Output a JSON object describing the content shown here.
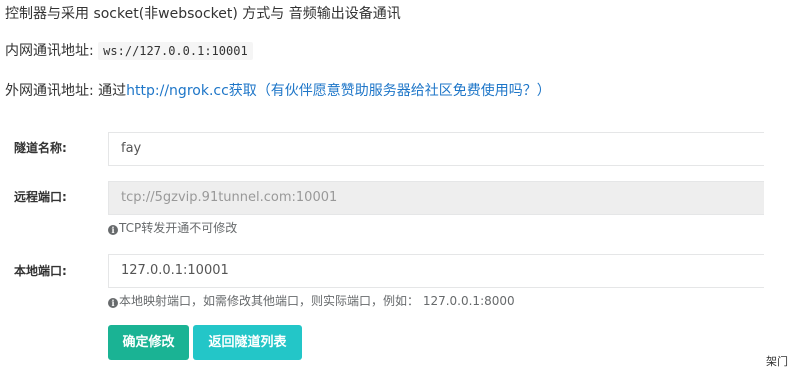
{
  "header": {
    "title": "控制器与采用 socket(非websocket) 方式与 音频输出设备通讯",
    "lan_label": "内网通讯地址:",
    "lan_address": "ws://127.0.0.1:10001",
    "wan_label": "外网通讯地址:",
    "wan_prefix": "通过",
    "wan_link": "http://ngrok.cc获取（有伙伴愿意赞助服务器给社区免费使用吗？）"
  },
  "form": {
    "tunnel_name_label": "隧道名称:",
    "tunnel_name_value": "fay",
    "remote_port_label": "远程端口:",
    "remote_port_value": "tcp://5gzvip.91tunnel.com:10001",
    "remote_port_help": "TCP转发开通不可修改",
    "local_port_label": "本地端口:",
    "local_port_value": "127.0.0.1:10001",
    "local_port_help": "本地映射端口，如需修改其他端口，则实际端口，例如： 127.0.0.1:8000",
    "info_icon_glyph": "i"
  },
  "buttons": {
    "confirm": "确定修改",
    "back": "返回隧道列表"
  },
  "corner_text": "架门",
  "colors": {
    "primary": "#1ab394",
    "info": "#23c6c8",
    "link": "#1e76c8"
  }
}
